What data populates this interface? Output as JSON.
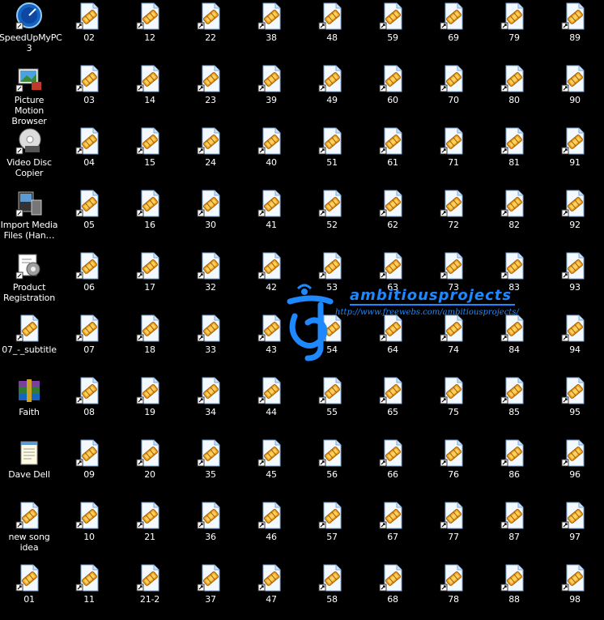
{
  "desktop": {
    "app_icons": [
      {
        "label": "SpeedUpMyPC 3",
        "icon": "speedometer-icon"
      },
      {
        "label": "Picture Motion Browser",
        "icon": "photo-browser-icon"
      },
      {
        "label": "Video Disc Copier",
        "icon": "disc-copier-icon"
      },
      {
        "label": "Import Media Files (Han…",
        "icon": "import-media-icon"
      },
      {
        "label": "Product Registration",
        "icon": "registration-icon"
      },
      {
        "label": "07_-_subtitle",
        "icon": "file-icon"
      },
      {
        "label": "Faith",
        "icon": "winrar-archive-icon"
      },
      {
        "label": "Dave Dell",
        "icon": "notepad-icon"
      },
      {
        "label": "new song idea",
        "icon": "file-icon"
      },
      {
        "label": "01",
        "icon": "file-icon"
      }
    ],
    "file_columns": [
      [
        "02",
        "03",
        "04",
        "05",
        "06",
        "07",
        "08",
        "09",
        "10",
        "11"
      ],
      [
        "12",
        "14",
        "15",
        "16",
        "17",
        "18",
        "19",
        "20",
        "21",
        "21-2"
      ],
      [
        "22",
        "23",
        "24",
        "30",
        "32",
        "33",
        "34",
        "35",
        "36",
        "37"
      ],
      [
        "38",
        "39",
        "40",
        "41",
        "42",
        "43",
        "44",
        "45",
        "46",
        "47"
      ],
      [
        "48",
        "49",
        "51",
        "52",
        "53",
        "54",
        "55",
        "56",
        "57",
        "58"
      ],
      [
        "59",
        "60",
        "61",
        "62",
        "63",
        "64",
        "65",
        "66",
        "67",
        "68"
      ],
      [
        "69",
        "70",
        "71",
        "72",
        "73",
        "74",
        "75",
        "76",
        "77",
        "78"
      ],
      [
        "79",
        "80",
        "81",
        "82",
        "83",
        "84",
        "85",
        "86",
        "87",
        "88"
      ],
      [
        "89",
        "90",
        "91",
        "92",
        "93",
        "94",
        "95",
        "96",
        "97",
        "98"
      ]
    ]
  },
  "watermark": {
    "title": "ambitiousprojects",
    "url": "http://www.freewebs.com/ambitiousprojects/"
  },
  "colors": {
    "background": "#000000",
    "watermark": "#1e88ff"
  }
}
